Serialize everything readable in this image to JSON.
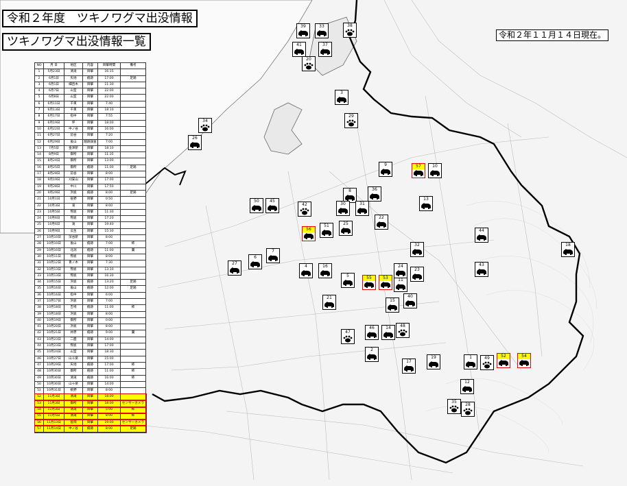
{
  "title": "令和２年度　ツキノワグマ出没情報",
  "subtitle": "ツキノワグマ出没情報一覧",
  "as_of": "令和２年１１月１４日現在。",
  "table": {
    "headers": [
      "NO",
      "月 日",
      "地区",
      "内容",
      "目撃時間",
      "備考"
    ],
    "rows": [
      [
        "1",
        "5月23日",
        "清滝",
        "目撃",
        "16:15",
        ""
      ],
      [
        "2",
        "6月1日",
        "矢地",
        "痕跡",
        "17:00",
        "足跡"
      ],
      [
        "3",
        "6月1日",
        "細呂木",
        "目撃",
        "11:30",
        ""
      ],
      [
        "4",
        "6月7日",
        "山室",
        "目撃",
        "22:00",
        ""
      ],
      [
        "5",
        "6月8日",
        "山室",
        "目撃",
        "22:00",
        ""
      ],
      [
        "6",
        "6月11日",
        "千束",
        "目撃",
        "7:40",
        ""
      ],
      [
        "7",
        "6月13日",
        "千束",
        "目撃",
        "18:10",
        ""
      ],
      [
        "8",
        "6月17日",
        "指中",
        "目撃",
        "7:55",
        ""
      ],
      [
        "9",
        "6月19日",
        "坪",
        "目撃",
        "18:00",
        ""
      ],
      [
        "10",
        "6月22日",
        "中ノ谷",
        "目撃",
        "16:00",
        ""
      ],
      [
        "11",
        "6月27日",
        "前谷",
        "目撃",
        "7:20",
        ""
      ],
      [
        "12",
        "6月29日",
        "後山",
        "踏跡調査",
        "7:00",
        ""
      ],
      [
        "13",
        "7月5日",
        "金津新",
        "目撃",
        "18:10",
        ""
      ],
      [
        "14",
        "8月9日",
        "御所",
        "目撃",
        "11:35",
        ""
      ],
      [
        "15",
        "8月24日",
        "御所",
        "目撃",
        "13:00",
        ""
      ],
      [
        "16",
        "8月25日",
        "御所",
        "痕跡",
        "11:00",
        "足跡"
      ],
      [
        "17",
        "8月28日",
        "前谷",
        "目撃",
        "8:00",
        ""
      ],
      [
        "18",
        "9月19日",
        "刈安山",
        "目撃",
        "17:00",
        ""
      ],
      [
        "19",
        "9月28日",
        "中川",
        "目撃",
        "17:50",
        ""
      ],
      [
        "20",
        "9月29日",
        "浜坂",
        "痕跡",
        "8:00",
        "足跡"
      ],
      [
        "21",
        "10月1日",
        "笹野",
        "目撃",
        "0:50",
        ""
      ],
      [
        "22",
        "10月3日",
        "滝",
        "目撃",
        "8:00",
        ""
      ],
      [
        "23",
        "10月5日",
        "熊坂",
        "目撃",
        "11:30",
        ""
      ],
      [
        "24",
        "10月6日",
        "熊坂",
        "目撃",
        "17:20",
        ""
      ],
      [
        "25",
        "10月6日",
        "滝",
        "目撃",
        "19:40",
        ""
      ],
      [
        "26",
        "10月9日",
        "瓜生",
        "目撃",
        "15:30",
        ""
      ],
      [
        "27",
        "10月10日",
        "深谷新",
        "目撃",
        "8:00",
        ""
      ],
      [
        "28",
        "10月10日",
        "後山",
        "痕跡",
        "7:00",
        "柿"
      ],
      [
        "29",
        "10月10日",
        "北潟",
        "痕跡",
        "11:00",
        "糞"
      ],
      [
        "30",
        "10月11日",
        "熊坂",
        "目撃",
        "8:00",
        ""
      ],
      [
        "31",
        "10月12日",
        "青ノ木",
        "目撃",
        "7:30",
        ""
      ],
      [
        "32",
        "10月13日",
        "熊坂",
        "目撃",
        "13:10",
        ""
      ],
      [
        "33",
        "10月13日",
        "熊坂",
        "目撃",
        "16:30",
        ""
      ],
      [
        "34",
        "10月15日",
        "浜坂",
        "痕跡",
        "13:20",
        "足跡"
      ],
      [
        "35",
        "10月16日",
        "後山",
        "痕跡",
        "12:00",
        "足跡"
      ],
      [
        "36",
        "10月16日",
        "指中",
        "目撃",
        "6:00",
        ""
      ],
      [
        "37",
        "10月17日",
        "浜坂",
        "目撃",
        "7:00",
        ""
      ],
      [
        "38",
        "10月18日",
        "吉崎",
        "痕跡",
        "11:00",
        "柿"
      ],
      [
        "39",
        "10月18日",
        "浜坂",
        "目撃",
        "8:00",
        ""
      ],
      [
        "40",
        "10月19日",
        "御所",
        "目撃",
        "0:00",
        ""
      ],
      [
        "41",
        "10月20日",
        "浜坂",
        "目撃",
        "8:00",
        ""
      ],
      [
        "42",
        "10月21日",
        "井原",
        "痕跡",
        "9:00",
        "糞"
      ],
      [
        "43",
        "10月23日",
        "二面",
        "目撃",
        "14:00",
        ""
      ],
      [
        "44",
        "10月23日",
        "熊坂",
        "目撃",
        "17:00",
        ""
      ],
      [
        "45",
        "10月24日",
        "山室",
        "目撃",
        "18:30",
        ""
      ],
      [
        "46",
        "10月27日",
        "山十楽",
        "目撃",
        "15:00",
        ""
      ],
      [
        "47",
        "10月29日",
        "矢地",
        "痕跡",
        "17:00",
        "柿"
      ],
      [
        "48",
        "10月30日",
        "御所",
        "痕跡",
        "11:00",
        "柿"
      ],
      [
        "49",
        "10月30日",
        "清滝",
        "痕跡",
        "16:00",
        "柿"
      ],
      [
        "50",
        "10月30日",
        "山十楽",
        "目撃",
        "14:00",
        ""
      ],
      [
        "51",
        "10月31日",
        "桃野",
        "目撃",
        "8:00",
        ""
      ],
      [
        "52",
        "11月3日",
        "清滝",
        "目撃",
        "18:00",
        ""
      ],
      [
        "53",
        "11月3日",
        "御所",
        "目撃",
        "18:00",
        "センサーカメラ"
      ],
      [
        "54",
        "11月3日",
        "清滝",
        "目撃",
        "5:00",
        "柿"
      ],
      [
        "55",
        "11月5日",
        "清滝",
        "目撃",
        "8:00",
        "柿"
      ],
      [
        "56",
        "11月13日",
        "笹岡",
        "目撃",
        "19:00",
        "センサーカメラ"
      ],
      [
        "57",
        "11月14日",
        "中ノ谷",
        "痕跡",
        "8:00",
        "足跡"
      ]
    ]
  },
  "markers": [
    {
      "n": "1",
      "t": "bear"
    },
    {
      "n": "2",
      "t": "bear"
    },
    {
      "n": "3",
      "t": "bear"
    },
    {
      "n": "4",
      "t": "bear"
    },
    {
      "n": "5",
      "t": "bear"
    },
    {
      "n": "6",
      "t": "bear"
    },
    {
      "n": "7",
      "t": "bear"
    },
    {
      "n": "8",
      "t": "bear"
    },
    {
      "n": "9",
      "t": "bear"
    },
    {
      "n": "10",
      "t": "bear"
    },
    {
      "n": "11",
      "t": "bear"
    },
    {
      "n": "12",
      "t": "bear"
    },
    {
      "n": "13",
      "t": "bear"
    },
    {
      "n": "14",
      "t": "bear"
    },
    {
      "n": "15",
      "t": "bear"
    },
    {
      "n": "16",
      "t": "bear"
    },
    {
      "n": "17",
      "t": "bear"
    },
    {
      "n": "18",
      "t": "bear"
    },
    {
      "n": "19",
      "t": "bear"
    },
    {
      "n": "20",
      "t": "paw"
    },
    {
      "n": "21",
      "t": "bear"
    },
    {
      "n": "22",
      "t": "bear"
    },
    {
      "n": "23",
      "t": "bear"
    },
    {
      "n": "24",
      "t": "bear"
    },
    {
      "n": "25",
      "t": "bear"
    },
    {
      "n": "26",
      "t": "bear"
    },
    {
      "n": "27",
      "t": "bear"
    },
    {
      "n": "28",
      "t": "paw"
    },
    {
      "n": "29",
      "t": "paw"
    },
    {
      "n": "30",
      "t": "bear"
    },
    {
      "n": "31",
      "t": "bear"
    },
    {
      "n": "32",
      "t": "bear"
    },
    {
      "n": "33",
      "t": "bear"
    },
    {
      "n": "34",
      "t": "paw"
    },
    {
      "n": "35",
      "t": "paw"
    },
    {
      "n": "36",
      "t": "bear"
    },
    {
      "n": "37",
      "t": "bear"
    },
    {
      "n": "38",
      "t": "paw"
    },
    {
      "n": "39",
      "t": "bear"
    },
    {
      "n": "40",
      "t": "bear"
    },
    {
      "n": "41",
      "t": "bear"
    },
    {
      "n": "42",
      "t": "paw"
    },
    {
      "n": "43",
      "t": "bear"
    },
    {
      "n": "44",
      "t": "bear"
    },
    {
      "n": "45",
      "t": "bear"
    },
    {
      "n": "46",
      "t": "bear"
    },
    {
      "n": "47",
      "t": "paw"
    },
    {
      "n": "48",
      "t": "paw"
    },
    {
      "n": "49",
      "t": "paw"
    },
    {
      "n": "50",
      "t": "bear"
    },
    {
      "n": "51",
      "t": "bear"
    },
    {
      "n": "52",
      "t": "bear"
    },
    {
      "n": "53",
      "t": "bear"
    },
    {
      "n": "54",
      "t": "bear"
    },
    {
      "n": "55",
      "t": "bear"
    },
    {
      "n": "56",
      "t": "bear"
    },
    {
      "n": "57",
      "t": "bear"
    }
  ],
  "colors": {
    "highlight": "#ffff00",
    "new_border": "#e00000",
    "boundary": "#000000"
  }
}
